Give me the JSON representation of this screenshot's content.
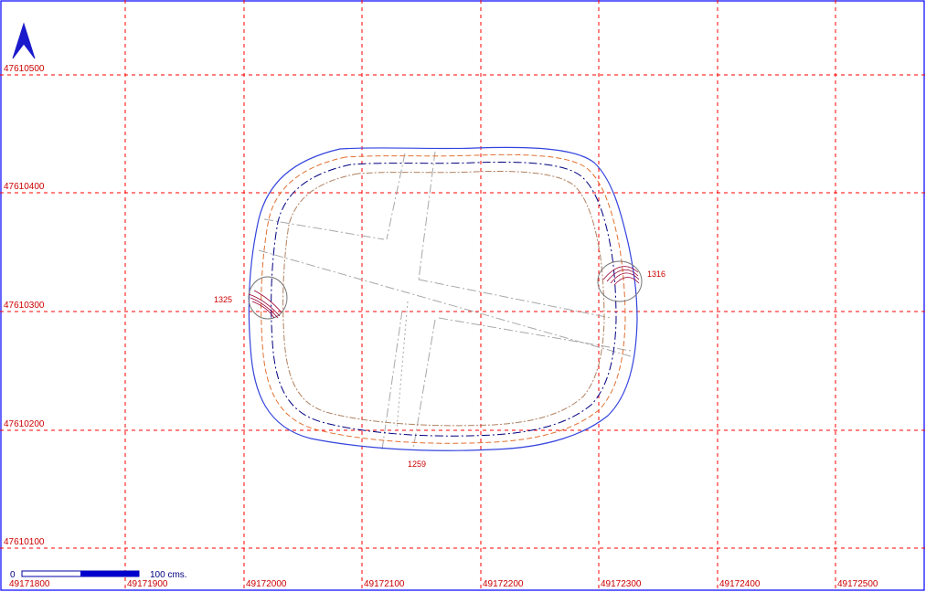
{
  "grid": {
    "x_labels": [
      "49171800",
      "49171900",
      "49172000",
      "49172100",
      "49172200",
      "49172300",
      "49172400",
      "49172500"
    ],
    "y_labels": [
      "47610500",
      "47610400",
      "47610300",
      "47610200",
      "47610100"
    ]
  },
  "points": [
    {
      "id": "1316"
    },
    {
      "id": "1325"
    },
    {
      "id": "1259"
    }
  ],
  "scale": {
    "start_label": "0",
    "end_label": "100 cms."
  },
  "colors": {
    "grid": "#ff0000",
    "frame": "#0000ff",
    "outer_contour": "#3344dd",
    "orange_contour": "#e07030",
    "navy_contour": "#000080",
    "tan_contour": "#b08060",
    "survey_lines": "#a8a8a8"
  },
  "icons": {
    "north": "north-arrow-icon"
  }
}
